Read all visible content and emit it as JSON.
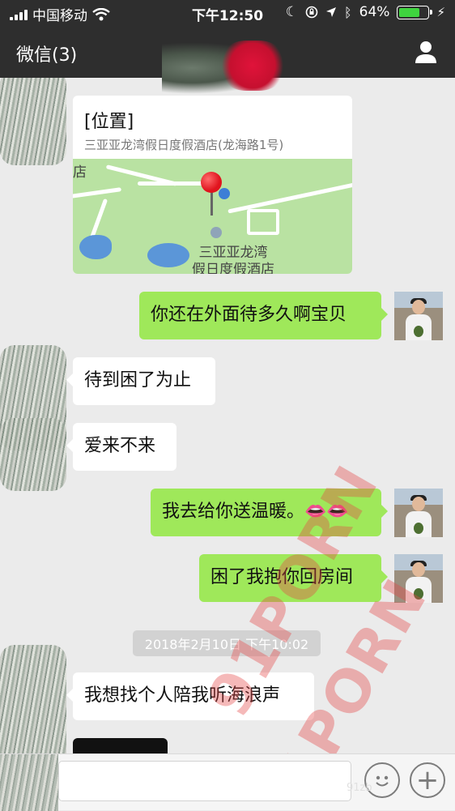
{
  "status_bar": {
    "carrier": "中国移动",
    "time": "下午12:50",
    "battery": "64%",
    "battery_level": 0.64
  },
  "nav": {
    "back_label": "微信(3)",
    "profile_icon": "person-icon"
  },
  "messages": {
    "location": {
      "title": "[位置]",
      "address": "三亚亚龙湾假日度假酒店(龙海路1号)",
      "map_label_line1": "三亚亚龙湾",
      "map_label_line2": "假日度假酒店",
      "map_corner": "店"
    },
    "m1": "你还在外面待多久啊宝贝",
    "m2": "待到困了为止",
    "m3": "爱来不来",
    "m4": "我去给你送温暖。👄👄",
    "m5": "困了我抱你回房间",
    "timestamp": "2018年2月10日 下午10:02",
    "m6": "我想找个人陪我听海浪声"
  },
  "watermarks": [
    "91PORN",
    "91PORN"
  ],
  "input": {
    "emoji_icon": "emoji-icon",
    "plus_label": "+",
    "watermark_small": "91zb"
  },
  "colors": {
    "nav_bg": "#2e2e2e",
    "chat_bg": "#ebebeb",
    "out_bubble": "#9fe85a",
    "in_bubble": "#ffffff"
  }
}
